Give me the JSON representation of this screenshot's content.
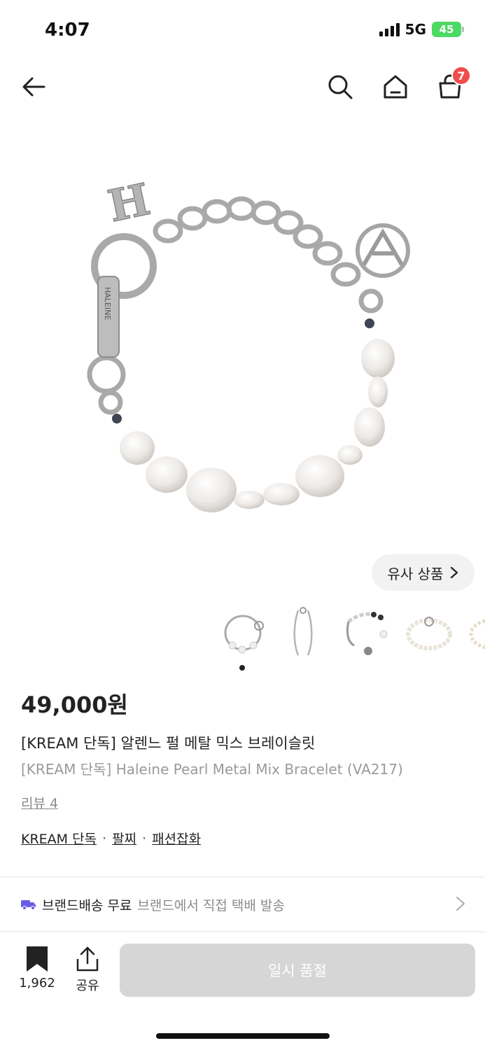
{
  "status": {
    "time": "4:07",
    "network": "5G",
    "battery": "45"
  },
  "nav": {
    "cart_badge": "7"
  },
  "similar_button": {
    "label": "유사 상품"
  },
  "product": {
    "price": "49,000원",
    "title_ko": "[KREAM 단독] 알렌느 펄 메탈 믹스 브레이슬릿",
    "title_en": "[KREAM 단독] Haleine Pearl Metal Mix Bracelet (VA217)",
    "review": "리뷰 4",
    "categories": [
      "KREAM 단독",
      "팔찌",
      "패션잡화"
    ],
    "category_separator": "·"
  },
  "shipping": {
    "label": "브랜드배송 무료",
    "description": "브랜드에서 직접 택배 발송"
  },
  "bottom": {
    "bookmark_count": "1,962",
    "share_label": "공유",
    "action_label": "일시 품절"
  },
  "colors": {
    "badge": "#f04c4c",
    "battery": "#4cd964",
    "shipping_icon": "#6b5ce7",
    "disabled_button": "#d6d6d6"
  },
  "icons": [
    "back-arrow-icon",
    "search-icon",
    "home-icon",
    "shopping-bag-icon",
    "chevron-right-icon",
    "truck-icon",
    "bookmark-icon",
    "share-icon"
  ]
}
